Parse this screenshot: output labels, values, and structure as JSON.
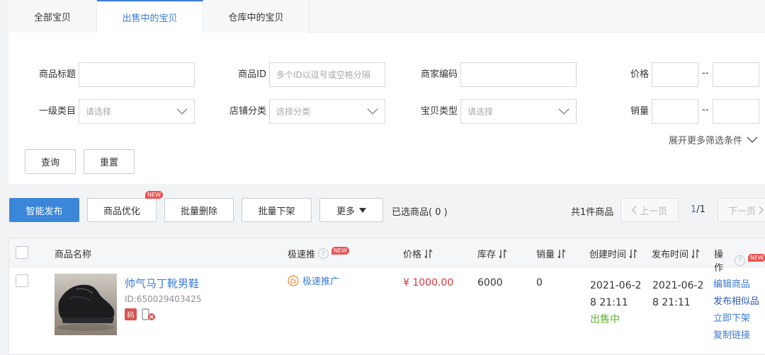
{
  "tabs": [
    {
      "label": "全部宝贝",
      "active": false
    },
    {
      "label": "出售中的宝贝",
      "active": true
    },
    {
      "label": "仓库中的宝贝",
      "active": false
    }
  ],
  "filters": {
    "title_label": "商品标题",
    "id_label": "商品ID",
    "id_placeholder": "多个ID以逗号或空格分隔",
    "code_label": "商家编码",
    "price_label": "价格",
    "category_label": "一级类目",
    "category_placeholder": "请选择",
    "shop_cat_label": "店铺分类",
    "shop_cat_placeholder": "选择分类",
    "type_label": "宝贝类型",
    "type_placeholder": "请选择",
    "sales_label": "销量",
    "range_sep": "--",
    "more_filters": "展开更多筛选条件",
    "query_button": "查询",
    "reset_button": "重置"
  },
  "toolbar": {
    "smart_publish": "智能发布",
    "optimize": "商品优化",
    "new_badge": "NEW",
    "batch_delete": "批量删除",
    "batch_offline": "批量下架",
    "more": "更多",
    "selected": "已选商品( 0 )",
    "total": "共1件商品",
    "prev_page": "上一页",
    "page_indicator": "1/1",
    "next_page": "下一页"
  },
  "table": {
    "headers": {
      "name": "商品名称",
      "promo": "极速推",
      "price": "价格",
      "stock": "库存",
      "sales": "销量",
      "created": "创建时间",
      "published": "发布时间",
      "ops": "操作"
    },
    "rows": [
      {
        "title": "帅气马丁靴男鞋",
        "id_text": "ID:650029403425",
        "code_tag": "码",
        "promo": "极速推广",
        "price": "¥ 1000.00",
        "stock": "6000",
        "sales": "0",
        "created_line1": "2021-06-2",
        "created_line2": "8 21:11",
        "status": "出售中",
        "published_line1": "2021-06-2",
        "published_line2": "8 21:11",
        "ops": [
          "编辑商品",
          "发布相似品",
          "立即下架",
          "复制链接"
        ]
      }
    ]
  },
  "colors": {
    "accent": "#3d7ad6",
    "primary_button": "#3b86d9",
    "price": "#d9363e",
    "status_on_sale": "#60b42e",
    "new_badge": "#f05050"
  },
  "icons": {
    "chevron": "chevron-down-icon",
    "sort": "sort-icon",
    "help": "question-circle-icon",
    "promo": "promo-hand-icon",
    "mobile": "mobile-disabled-icon"
  }
}
